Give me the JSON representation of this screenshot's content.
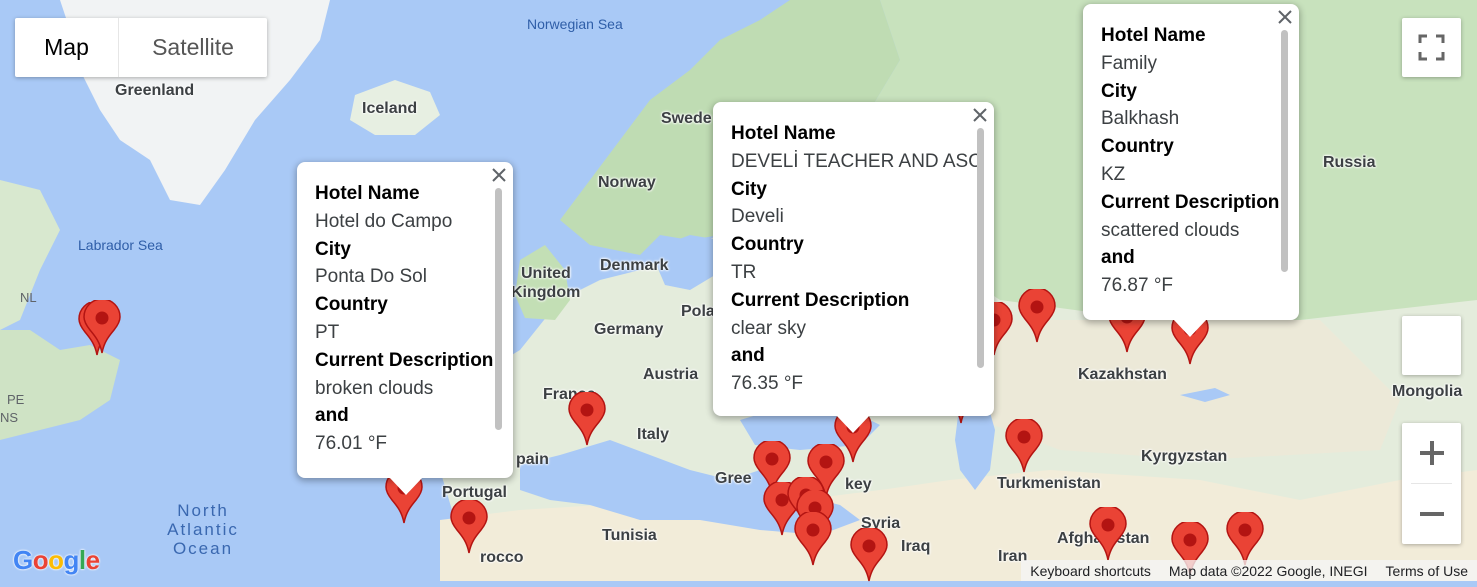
{
  "map_type": {
    "map_label": "Map",
    "satellite_label": "Satellite",
    "selected": "Map"
  },
  "labels": {
    "greenland": "Greenland",
    "iceland": "Iceland",
    "norwegian_sea": "Norwegian Sea",
    "sweden": "Swede",
    "norway": "Norway",
    "russia": "Russia",
    "labrador_sea": "Labrador Sea",
    "nl": "NL",
    "pe": "PE",
    "ns": "NS",
    "united_kingdom_1": "United",
    "united_kingdom_2": "Kingdom",
    "denmark": "Denmark",
    "germany": "Germany",
    "poland": "Pola",
    "austria": "Austria",
    "france": "France",
    "italy": "Italy",
    "spain": "pain",
    "portugal": "Portugal",
    "morocco": "rocco",
    "tunisia": "Tunisia",
    "greece": "Gree",
    "turkey": "key",
    "syria": "Syria",
    "iraq": "Iraq",
    "iran": "Iran",
    "kazakhstan": "Kazakhstan",
    "mongolia": "Mongolia",
    "kyrgyzstan": "Kyrgyzstan",
    "turkmenistan": "Turkmenistan",
    "afghanistan": "Afghanistan",
    "north_atlantic_1": "North",
    "north_atlantic_2": "Atlantic",
    "north_atlantic_3": "Ocean"
  },
  "info_windows": [
    {
      "hotel_label": "Hotel Name",
      "hotel": "Hotel do Campo",
      "city_label": "City",
      "city": "Ponta Do Sol",
      "country_label": "Country",
      "country": "PT",
      "desc_label": "Current Description",
      "desc": "broken clouds",
      "and_label": "and",
      "temp": "76.01 °F"
    },
    {
      "hotel_label": "Hotel Name",
      "hotel": "DEVELİ TEACHER AND ASO",
      "city_label": "City",
      "city": "Develi",
      "country_label": "Country",
      "country": "TR",
      "desc_label": "Current Description",
      "desc": "clear sky",
      "and_label": "and",
      "temp": "76.35 °F"
    },
    {
      "hotel_label": "Hotel Name",
      "hotel": "Family",
      "city_label": "City",
      "city": "Balkhash",
      "country_label": "Country",
      "country": "KZ",
      "desc_label": "Current Description",
      "desc": "scattered clouds",
      "and_label": "and",
      "temp": "76.87 °F"
    }
  ],
  "footer": {
    "shortcuts": "Keyboard shortcuts",
    "map_data": "Map data ©2022 Google, INEGI",
    "terms": "Terms of Use"
  },
  "logo_text": "Google",
  "icons": {
    "fullscreen": "fullscreen-icon",
    "pegman": "pegman-icon",
    "zoom_in": "plus-icon",
    "zoom_out": "minus-icon",
    "close": "close-icon",
    "marker": "map-marker-icon"
  },
  "colors": {
    "water": "#a9c9f6",
    "land": "#e9efe4",
    "forest": "#bcdcb0",
    "desert": "#f3ecdc",
    "marker": "#ea4335",
    "marker_dark": "#b31412"
  }
}
